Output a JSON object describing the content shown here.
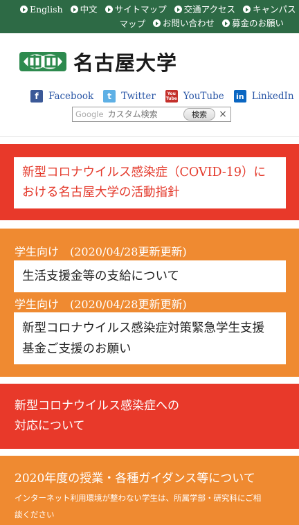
{
  "topnav": {
    "row1": [
      "English",
      "中文",
      "サイトマップ",
      "交通アクセス",
      "キャンパス"
    ],
    "row2_continuation": "マップ",
    "row2": [
      "お問い合わせ",
      "募金のお願い"
    ]
  },
  "logo": {
    "text": "名古屋大学"
  },
  "social": {
    "facebook": "Facebook",
    "twitter": "Twitter",
    "youtube": "YouTube",
    "linkedin": "LinkedIn",
    "youtube_icon_text": "You Tube"
  },
  "search": {
    "brand": "Google",
    "placeholder": "カスタム検索",
    "button": "検索",
    "clear": "×"
  },
  "alert": {
    "line1": "新型コロナウイルス感染症（COVID-19）に",
    "line2": "おける名古屋大学の活動指針"
  },
  "students": {
    "items": [
      {
        "label": "学生向け　(2020/04/28更新更新)",
        "title_lines": [
          "生活支援金等の支給について"
        ]
      },
      {
        "label": "学生向け　(2020/04/28更新更新)",
        "title_lines": [
          "新型コロナウイルス感染症対策緊急学生支援",
          "基金ご支援のお願い"
        ]
      }
    ]
  },
  "response": {
    "line1": "新型コロナウイルス感染症への",
    "line2": "対応について"
  },
  "classes": {
    "title": "2020年度の授業・各種ガイダンス等について",
    "sub1": "インターネット利用環境が整わない学生は、所属学部・研究科にご相",
    "sub2": "談ください"
  },
  "colors": {
    "green": "#2d6a45",
    "red": "#e8392a",
    "orange": "#ef8a31",
    "link_blue": "#2a56a6"
  }
}
